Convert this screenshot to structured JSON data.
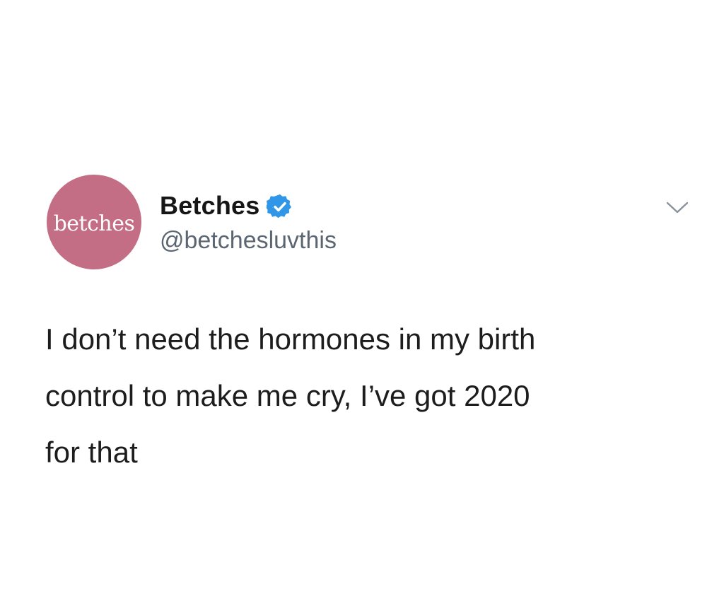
{
  "tweet": {
    "avatar": {
      "logo_text": "betches",
      "color": "#c46e86"
    },
    "author": {
      "display_name": "Betches",
      "handle": "@betchesluvthis",
      "verified": true,
      "verified_icon": "verified-badge-icon",
      "verified_color": "#2f96e8"
    },
    "menu_icon": "chevron-down-icon",
    "text": "I don’t need the hormones in my birth\ncontrol to make me cry, I’ve got 2020\nfor that"
  }
}
